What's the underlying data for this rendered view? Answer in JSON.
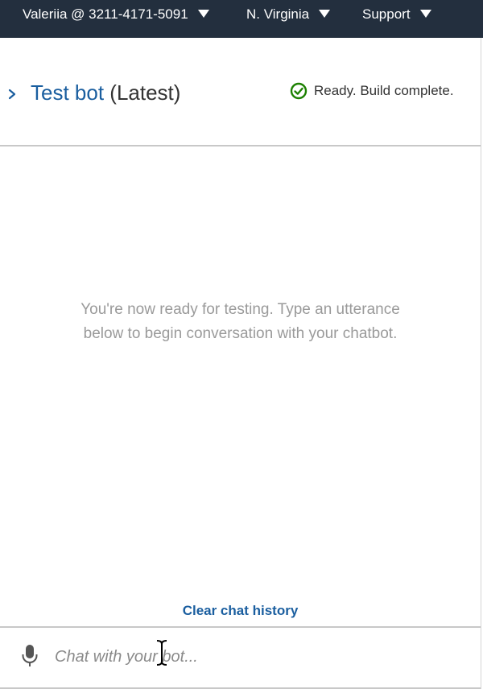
{
  "topbar": {
    "account_label": "Valeriia @ 3211-4171-5091",
    "region_label": "N. Virginia",
    "support_label": "Support"
  },
  "header": {
    "title_link": "Test bot",
    "title_suffix": "(Latest)",
    "status_text": "Ready. Build complete."
  },
  "chat": {
    "empty_message_line1": "You're now ready for testing. Type an utterance",
    "empty_message_line2": "below to begin conversation with your chatbot.",
    "clear_history_label": "Clear chat history"
  },
  "input": {
    "placeholder": "Chat with your bot...",
    "value": ""
  },
  "icons": {
    "expand": "chevron-right-icon",
    "status": "check-circle-icon",
    "mic": "microphone-icon",
    "caret": "caret-down-icon",
    "cursor": "text-cursor-icon"
  },
  "colors": {
    "topbar_bg": "#232f3e",
    "link_blue": "#1a5e9f",
    "success_green": "#1d8102",
    "muted_text": "#9a9a9a"
  }
}
